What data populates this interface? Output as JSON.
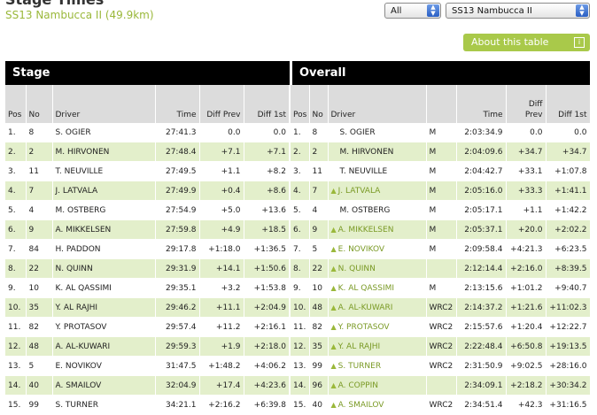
{
  "page": {
    "title": "Stage Times",
    "subtitle": "SS13 Nambucca II (49.9km)"
  },
  "filters": {
    "class_value": "All",
    "stage_value": "SS13 Nambucca II"
  },
  "about_button": {
    "label": "About this table"
  },
  "sections": {
    "stage": "Stage",
    "overall": "Overall"
  },
  "columns": {
    "pos": "Pos",
    "no": "No",
    "driver": "Driver",
    "time": "Time",
    "diff_prev": "Diff Prev",
    "diff_1st": "Diff 1st"
  },
  "stage_rows": [
    {
      "pos": "1.",
      "no": "8",
      "driver": "S. OGIER",
      "time": "27:41.3",
      "diff_prev": "0.0",
      "diff_1st": "0.0"
    },
    {
      "pos": "2.",
      "no": "2",
      "driver": "M. HIRVONEN",
      "time": "27:48.4",
      "diff_prev": "+7.1",
      "diff_1st": "+7.1"
    },
    {
      "pos": "3.",
      "no": "11",
      "driver": "T. NEUVILLE",
      "time": "27:49.5",
      "diff_prev": "+1.1",
      "diff_1st": "+8.2"
    },
    {
      "pos": "4.",
      "no": "7",
      "driver": "J. LATVALA",
      "time": "27:49.9",
      "diff_prev": "+0.4",
      "diff_1st": "+8.6"
    },
    {
      "pos": "5.",
      "no": "4",
      "driver": "M. OSTBERG",
      "time": "27:54.9",
      "diff_prev": "+5.0",
      "diff_1st": "+13.6"
    },
    {
      "pos": "6.",
      "no": "9",
      "driver": "A. MIKKELSEN",
      "time": "27:59.8",
      "diff_prev": "+4.9",
      "diff_1st": "+18.5"
    },
    {
      "pos": "7.",
      "no": "84",
      "driver": "H. PADDON",
      "time": "29:17.8",
      "diff_prev": "+1:18.0",
      "diff_1st": "+1:36.5"
    },
    {
      "pos": "8.",
      "no": "22",
      "driver": "N. QUINN",
      "time": "29:31.9",
      "diff_prev": "+14.1",
      "diff_1st": "+1:50.6"
    },
    {
      "pos": "9.",
      "no": "10",
      "driver": "K. AL QASSIMI",
      "time": "29:35.1",
      "diff_prev": "+3.2",
      "diff_1st": "+1:53.8"
    },
    {
      "pos": "10.",
      "no": "35",
      "driver": "Y. AL RAJHI",
      "time": "29:46.2",
      "diff_prev": "+11.1",
      "diff_1st": "+2:04.9"
    },
    {
      "pos": "11.",
      "no": "82",
      "driver": "Y. PROTASOV",
      "time": "29:57.4",
      "diff_prev": "+11.2",
      "diff_1st": "+2:16.1"
    },
    {
      "pos": "12.",
      "no": "48",
      "driver": "A. AL-KUWARI",
      "time": "29:59.3",
      "diff_prev": "+1.9",
      "diff_1st": "+2:18.0"
    },
    {
      "pos": "13.",
      "no": "5",
      "driver": "E. NOVIKOV",
      "time": "31:47.5",
      "diff_prev": "+1:48.2",
      "diff_1st": "+4:06.2"
    },
    {
      "pos": "14.",
      "no": "40",
      "driver": "A. SMAILOV",
      "time": "32:04.9",
      "diff_prev": "+17.4",
      "diff_1st": "+4:23.6"
    },
    {
      "pos": "15.",
      "no": "99",
      "driver": "S. TURNER",
      "time": "34:21.1",
      "diff_prev": "+2:16.2",
      "diff_1st": "+6:39.8"
    }
  ],
  "overall_rows": [
    {
      "pos": "1.",
      "no": "8",
      "up": false,
      "driver": "S. OGIER",
      "cls": "M",
      "time": "2:03:34.9",
      "diff_prev": "0.0",
      "diff_1st": "0.0"
    },
    {
      "pos": "2.",
      "no": "2",
      "up": false,
      "driver": "M. HIRVONEN",
      "cls": "M",
      "time": "2:04:09.6",
      "diff_prev": "+34.7",
      "diff_1st": "+34.7"
    },
    {
      "pos": "3.",
      "no": "11",
      "up": false,
      "driver": "T. NEUVILLE",
      "cls": "M",
      "time": "2:04:42.7",
      "diff_prev": "+33.1",
      "diff_1st": "+1:07.8"
    },
    {
      "pos": "4.",
      "no": "7",
      "up": true,
      "driver": "J. LATVALA",
      "cls": "M",
      "time": "2:05:16.0",
      "diff_prev": "+33.3",
      "diff_1st": "+1:41.1"
    },
    {
      "pos": "5.",
      "no": "4",
      "up": false,
      "driver": "M. OSTBERG",
      "cls": "M",
      "time": "2:05:17.1",
      "diff_prev": "+1.1",
      "diff_1st": "+1:42.2"
    },
    {
      "pos": "6.",
      "no": "9",
      "up": true,
      "driver": "A. MIKKELSEN",
      "cls": "M",
      "time": "2:05:37.1",
      "diff_prev": "+20.0",
      "diff_1st": "+2:02.2"
    },
    {
      "pos": "7.",
      "no": "5",
      "up": true,
      "driver": "E. NOVIKOV",
      "cls": "M",
      "time": "2:09:58.4",
      "diff_prev": "+4:21.3",
      "diff_1st": "+6:23.5"
    },
    {
      "pos": "8.",
      "no": "22",
      "up": true,
      "driver": "N. QUINN",
      "cls": "",
      "time": "2:12:14.4",
      "diff_prev": "+2:16.0",
      "diff_1st": "+8:39.5"
    },
    {
      "pos": "9.",
      "no": "10",
      "up": true,
      "driver": "K. AL QASSIMI",
      "cls": "M",
      "time": "2:13:15.6",
      "diff_prev": "+1:01.2",
      "diff_1st": "+9:40.7"
    },
    {
      "pos": "10.",
      "no": "48",
      "up": true,
      "driver": "A. AL-KUWARI",
      "cls": "WRC2",
      "time": "2:14:37.2",
      "diff_prev": "+1:21.6",
      "diff_1st": "+11:02.3"
    },
    {
      "pos": "11.",
      "no": "82",
      "up": true,
      "driver": "Y. PROTASOV",
      "cls": "WRC2",
      "time": "2:15:57.6",
      "diff_prev": "+1:20.4",
      "diff_1st": "+12:22.7"
    },
    {
      "pos": "12.",
      "no": "35",
      "up": true,
      "driver": "Y. AL RAJHI",
      "cls": "WRC2",
      "time": "2:22:48.4",
      "diff_prev": "+6:50.8",
      "diff_1st": "+19:13.5"
    },
    {
      "pos": "13.",
      "no": "99",
      "up": true,
      "driver": "S. TURNER",
      "cls": "WRC2",
      "time": "2:31:50.9",
      "diff_prev": "+9:02.5",
      "diff_1st": "+28:16.0"
    },
    {
      "pos": "14.",
      "no": "96",
      "up": true,
      "driver": "A. COPPIN",
      "cls": "",
      "time": "2:34:09.1",
      "diff_prev": "+2:18.2",
      "diff_1st": "+30:34.2"
    },
    {
      "pos": "15.",
      "no": "40",
      "up": true,
      "driver": "A. SMAILOV",
      "cls": "WRC2",
      "time": "2:34:51.4",
      "diff_prev": "+42.3",
      "diff_1st": "+31:16.5"
    }
  ]
}
